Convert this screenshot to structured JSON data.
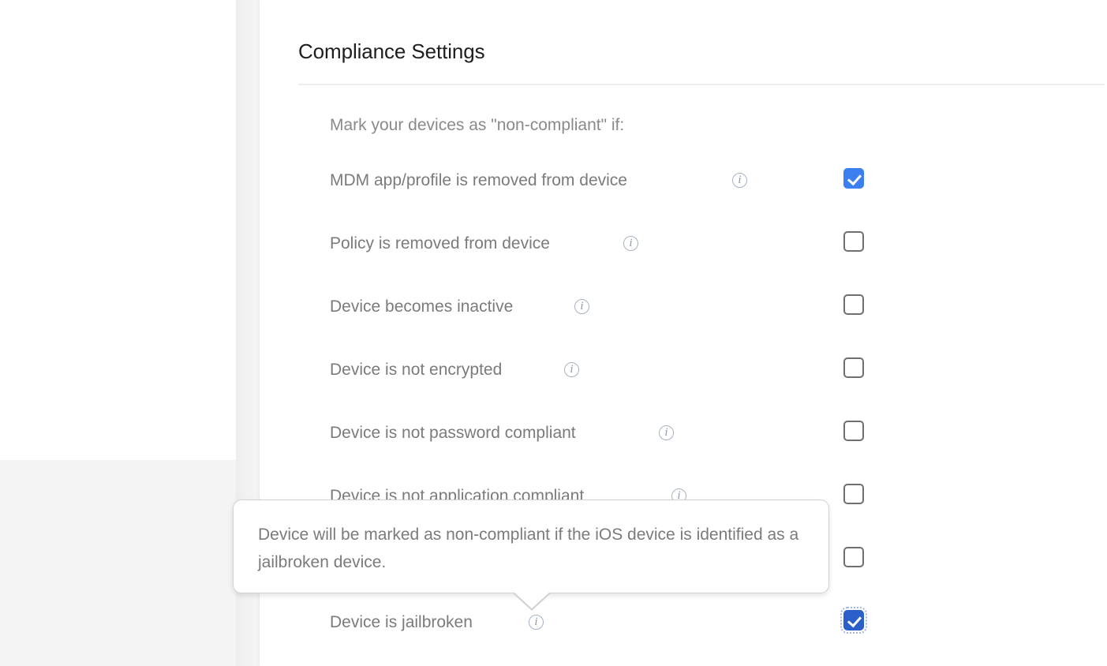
{
  "page": {
    "title": "Compliance Settings",
    "background_color": "#f4f4f4",
    "panel_color": "#ffffff"
  },
  "colors": {
    "title_text": "#1e1e1e",
    "label_text": "#7b7b7b",
    "divider": "#ededed",
    "checkbox_border": "#6f6f6f",
    "checkbox_checked": "#3b7ff0",
    "checkbox_checked_focused": "#2b5fc9",
    "info_icon": "#8d99ab",
    "tooltip_border": "#d2d2d2"
  },
  "intro": {
    "label": "Mark your devices as \"non-compliant\" if:"
  },
  "settings": [
    {
      "label": "MDM app/profile is removed from device",
      "info_icon": "info-circle-icon",
      "checked": true,
      "focused": false
    },
    {
      "label": "Policy is removed from device",
      "info_icon": "info-circle-icon",
      "checked": false,
      "focused": false
    },
    {
      "label": "Device becomes inactive",
      "info_icon": "info-circle-icon",
      "checked": false,
      "focused": false
    },
    {
      "label": "Device is not encrypted",
      "info_icon": "info-circle-icon",
      "checked": false,
      "focused": false
    },
    {
      "label": "Device is not password compliant",
      "info_icon": "info-circle-icon",
      "checked": false,
      "focused": false
    },
    {
      "label": "Device is not application compliant",
      "info_icon": "info-circle-icon",
      "checked": false,
      "focused": false
    },
    {
      "label": "",
      "info_icon": "",
      "checked": false,
      "focused": false
    },
    {
      "label": "Device is jailbroken",
      "info_icon": "info-circle-icon",
      "checked": true,
      "focused": true
    }
  ],
  "tooltip": {
    "text": "Device will be marked as non-compliant if the iOS device is identified as a jailbroken device.",
    "anchor_row_label": "Device is jailbroken"
  }
}
